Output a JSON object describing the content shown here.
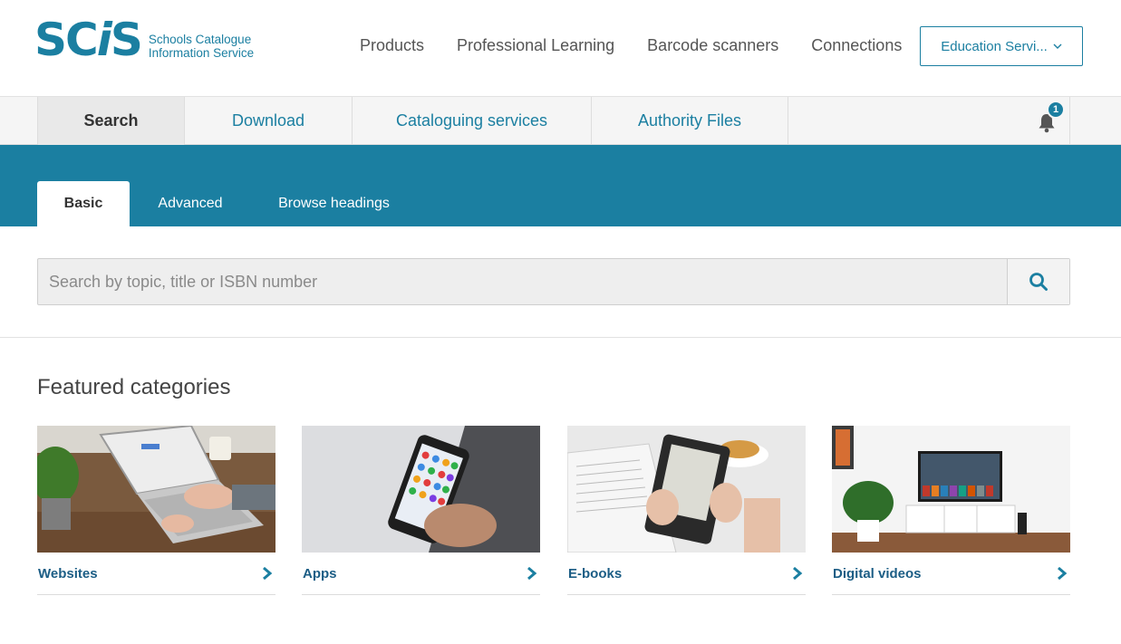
{
  "header": {
    "logo_mark": "SCIS",
    "logo_line1": "Schools Catalogue",
    "logo_line2": "Information Service",
    "nav": [
      "Products",
      "Professional Learning",
      "Barcode scanners",
      "Connections"
    ],
    "account_button": "Education Servi...",
    "account_icon": "chevron-down-icon"
  },
  "subnav": {
    "tabs": [
      "Search",
      "Download",
      "Cataloguing services",
      "Authority Files"
    ],
    "active": "Search",
    "notifications_count": "1"
  },
  "search_tabs": {
    "tabs": [
      "Basic",
      "Advanced",
      "Browse headings"
    ],
    "active": "Basic"
  },
  "search": {
    "placeholder": "Search by topic, title or ISBN number",
    "value": ""
  },
  "featured": {
    "title": "Featured categories",
    "cards": [
      {
        "label": "Websites",
        "icon": "chevron-right-icon"
      },
      {
        "label": "Apps",
        "icon": "chevron-right-icon"
      },
      {
        "label": "E-books",
        "icon": "chevron-right-icon"
      },
      {
        "label": "Digital videos",
        "icon": "chevron-right-icon"
      }
    ]
  },
  "colors": {
    "brand": "#1b7fa1",
    "link_dark": "#1b5d85"
  }
}
